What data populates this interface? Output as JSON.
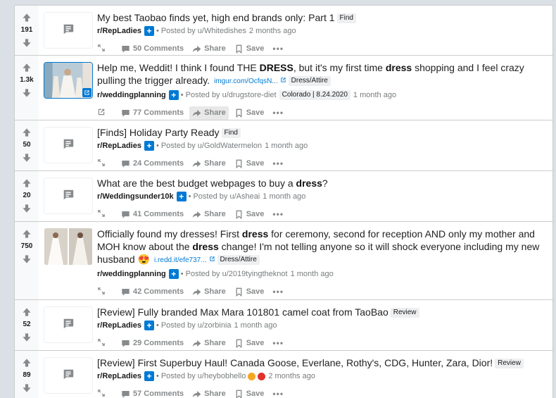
{
  "posts": [
    {
      "score": "191",
      "title_parts": [
        {
          "t": "My best Taobao finds yet, high end brands only: Part 1",
          "b": false
        }
      ],
      "flair": "Find",
      "domain": "",
      "subreddit": "r/RepLadies",
      "posted_by": "Posted by u/Whitedishes",
      "time": "2 months ago",
      "meta_flair": "",
      "comments": "50 Comments",
      "thumb": "text",
      "awards": []
    },
    {
      "score": "1.3k",
      "title_parts": [
        {
          "t": "Help me, Weddit! I think I found THE ",
          "b": false
        },
        {
          "t": "DRESS",
          "b": true
        },
        {
          "t": ", but it's my first time ",
          "b": false
        },
        {
          "t": "dress",
          "b": true
        },
        {
          "t": " shopping and I feel crazy pulling the trigger already.",
          "b": false
        }
      ],
      "flair": "Dress/Attire",
      "domain": "imgur.com/OcfqsN...",
      "subreddit": "r/weddingplanning",
      "posted_by": "Posted by u/drugstore-diet",
      "time": "1 month ago",
      "meta_flair": "Colorado | 8.24.2020",
      "comments": "77 Comments",
      "thumb": "image-link",
      "awards": []
    },
    {
      "score": "50",
      "title_parts": [
        {
          "t": "[Finds] Holiday Party Ready",
          "b": false
        }
      ],
      "flair": "Find",
      "domain": "",
      "subreddit": "r/RepLadies",
      "posted_by": "Posted by u/GoldWatermelon",
      "time": "1 month ago",
      "meta_flair": "",
      "comments": "24 Comments",
      "thumb": "text",
      "awards": []
    },
    {
      "score": "20",
      "title_parts": [
        {
          "t": "What are the best budget webpages to buy a ",
          "b": false
        },
        {
          "t": "dress",
          "b": true
        },
        {
          "t": "?",
          "b": false
        }
      ],
      "flair": "",
      "domain": "",
      "subreddit": "r/Weddingsunder10k",
      "posted_by": "Posted by u/Asheai",
      "time": "1 month ago",
      "meta_flair": "",
      "comments": "41 Comments",
      "thumb": "text",
      "awards": []
    },
    {
      "score": "750",
      "title_parts": [
        {
          "t": "Officially found my dresses! First ",
          "b": false
        },
        {
          "t": "dress",
          "b": true
        },
        {
          "t": " for ceremony, second for reception AND only my mother and MOH know about the ",
          "b": false
        },
        {
          "t": "dress",
          "b": true
        },
        {
          "t": " change! I'm not telling anyone so it will shock everyone including my new husband ",
          "b": false
        }
      ],
      "title_emoji": "😍",
      "flair": "Dress/Attire",
      "domain": "i.redd.it/efe737...",
      "subreddit": "r/weddingplanning",
      "posted_by": "Posted by u/2019tyingtheknot",
      "time": "1 month ago",
      "meta_flair": "",
      "comments": "42 Comments",
      "thumb": "image-pair",
      "awards": []
    },
    {
      "score": "52",
      "title_parts": [
        {
          "t": "[Review] Fully branded Max Mara 101801 camel coat from TaoBao",
          "b": false
        }
      ],
      "flair": "Review",
      "domain": "",
      "subreddit": "r/RepLadies",
      "posted_by": "Posted by u/zorbinia",
      "time": "1 month ago",
      "meta_flair": "",
      "comments": "29 Comments",
      "thumb": "text",
      "awards": []
    },
    {
      "score": "89",
      "title_parts": [
        {
          "t": "[Review] First Superbuy Haul! Canada Goose, Everlane, Rothy's, CDG, Hunter, Zara, Dior!",
          "b": false
        }
      ],
      "flair": "Review",
      "domain": "",
      "subreddit": "r/RepLadies",
      "posted_by": "Posted by u/heybobhello",
      "time": "2 months ago",
      "meta_flair": "",
      "comments": "57 Comments",
      "thumb": "text",
      "awards": [
        "#f5a623",
        "#e0322b"
      ]
    }
  ],
  "labels": {
    "share": "Share",
    "save": "Save",
    "more": "•••",
    "join": "+",
    "dot": "•"
  },
  "colors": {
    "accent": "#0079d3",
    "page_bg": "#dae0e6"
  }
}
